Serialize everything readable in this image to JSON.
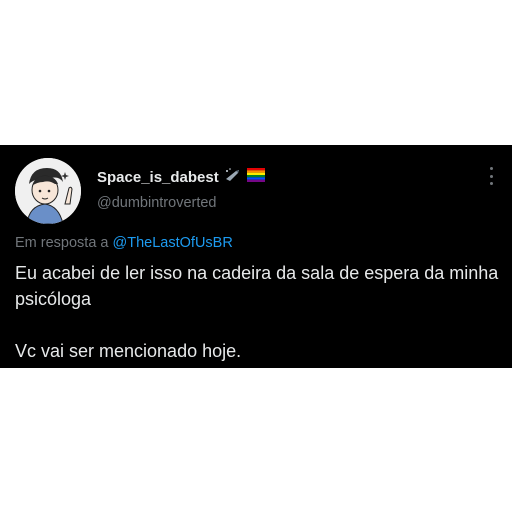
{
  "author": {
    "display_name": "Space_is_dabest",
    "handle": "@dumbintroverted",
    "badges": [
      "sparkle-rocket-emoji",
      "rainbow-flag-emoji"
    ]
  },
  "reply": {
    "prefix": "Em resposta a",
    "mention": "@TheLastOfUsBR"
  },
  "body": {
    "line1": "Eu acabei de ler isso na cadeira da sala de espera da minha psicóloga",
    "line2": "Vc vai ser mencionado hoje."
  },
  "colors": {
    "background": "#000000",
    "text": "#e7e9ea",
    "secondary": "#71767b",
    "link": "#1d9bf0"
  }
}
